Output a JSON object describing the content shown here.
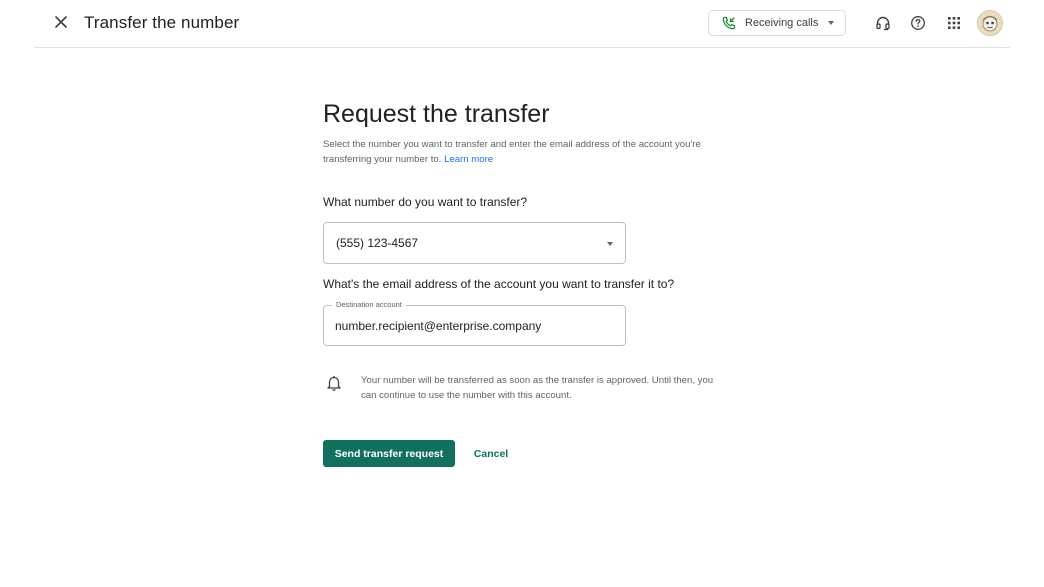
{
  "header": {
    "title": "Transfer the number",
    "close_icon": "close-icon",
    "status": {
      "label": "Receiving calls",
      "icon": "phone-incoming-icon",
      "icon_color": "#1e8e3e"
    },
    "icons": [
      "headset-icon",
      "help-icon",
      "apps-grid-icon"
    ],
    "avatar": "user-avatar"
  },
  "form": {
    "heading": "Request the transfer",
    "description": "Select the number you want to transfer and enter the email address of the account you're transferring your number to.",
    "learn_more": "Learn more",
    "number_question": "What number do you want to transfer?",
    "number_selected": "(555) 123-4567",
    "email_question": "What's the email address of the account you want to transfer it to?",
    "email_label": "Destination account",
    "email_value": "number.recipient@enterprise.company",
    "notice_icon": "bell-icon",
    "notice": "Your number will be transferred as soon as the transfer is approved. Until then, you can continue to use the number with this account.",
    "send_label": "Send transfer request",
    "cancel_label": "Cancel"
  },
  "colors": {
    "accent": "#12705e",
    "link": "#1a73e8"
  }
}
